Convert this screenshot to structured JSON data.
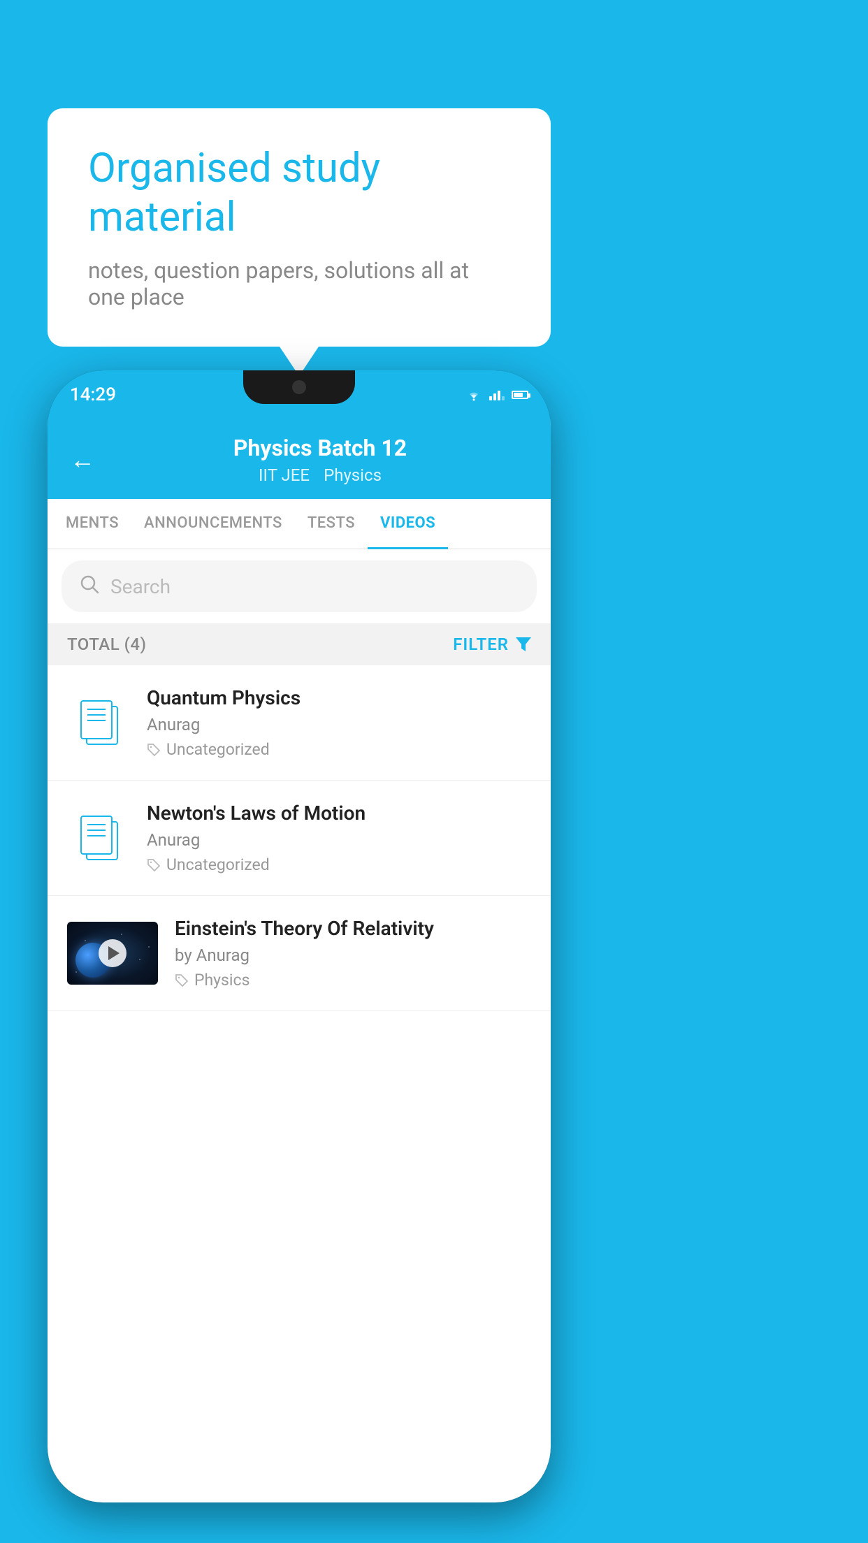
{
  "background_color": "#1ab7ea",
  "speech_bubble": {
    "title": "Organised study material",
    "subtitle": "notes, question papers, solutions all at one place"
  },
  "phone": {
    "status_bar": {
      "time": "14:29"
    },
    "header": {
      "back_label": "←",
      "title": "Physics Batch 12",
      "breadcrumb1": "IIT JEE",
      "breadcrumb2": "Physics"
    },
    "tabs": [
      {
        "label": "MENTS",
        "active": false
      },
      {
        "label": "ANNOUNCEMENTS",
        "active": false
      },
      {
        "label": "TESTS",
        "active": false
      },
      {
        "label": "VIDEOS",
        "active": true
      }
    ],
    "search": {
      "placeholder": "Search"
    },
    "filter_bar": {
      "total_label": "TOTAL (4)",
      "filter_label": "FILTER"
    },
    "videos": [
      {
        "title": "Quantum Physics",
        "author": "Anurag",
        "tag": "Uncategorized",
        "type": "file",
        "has_thumb": false
      },
      {
        "title": "Newton's Laws of Motion",
        "author": "Anurag",
        "tag": "Uncategorized",
        "type": "file",
        "has_thumb": false
      },
      {
        "title": "Einstein's Theory Of Relativity",
        "author_prefix": "by",
        "author": "Anurag",
        "tag": "Physics",
        "type": "video",
        "has_thumb": true
      }
    ]
  }
}
